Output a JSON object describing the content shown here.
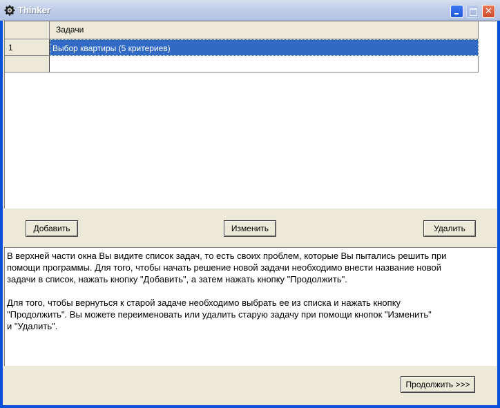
{
  "window": {
    "title": "Thinker",
    "icon": "gear-icon",
    "controls": [
      "minimize",
      "maximize",
      "close"
    ]
  },
  "grid": {
    "column_header": "Задачи",
    "rows": [
      {
        "number": "1",
        "task": "Выбор квартиры (5 критериев)",
        "selected": true
      },
      {
        "number": "",
        "task": "",
        "selected": false
      }
    ]
  },
  "buttons": {
    "add": "Добавить",
    "edit": "Изменить",
    "delete": "Удалить",
    "continue": "Продолжить >>>"
  },
  "info": {
    "paragraph1": "В верхней части окна Вы видите список задач, то есть своих проблем, которые Вы пытались решить при\nпомощи программы. Для того, чтобы начать решение новой задачи необходимо внести название новой\nзадачи в список, нажать кнопку \"Добавить\",  а затем  нажать кнопку \"Продолжить\".",
    "paragraph2": "Для того, чтобы вернуться к старой задаче необходимо выбрать ее из списка и нажать кнопку\n\"Продолжить\". Вы можете переименовать или удалить старую задачу при помощи кнопок \"Изменить\"\nи \"Удалить\"."
  },
  "colors": {
    "selection": "#316ac5",
    "face": "#ece9d8"
  }
}
